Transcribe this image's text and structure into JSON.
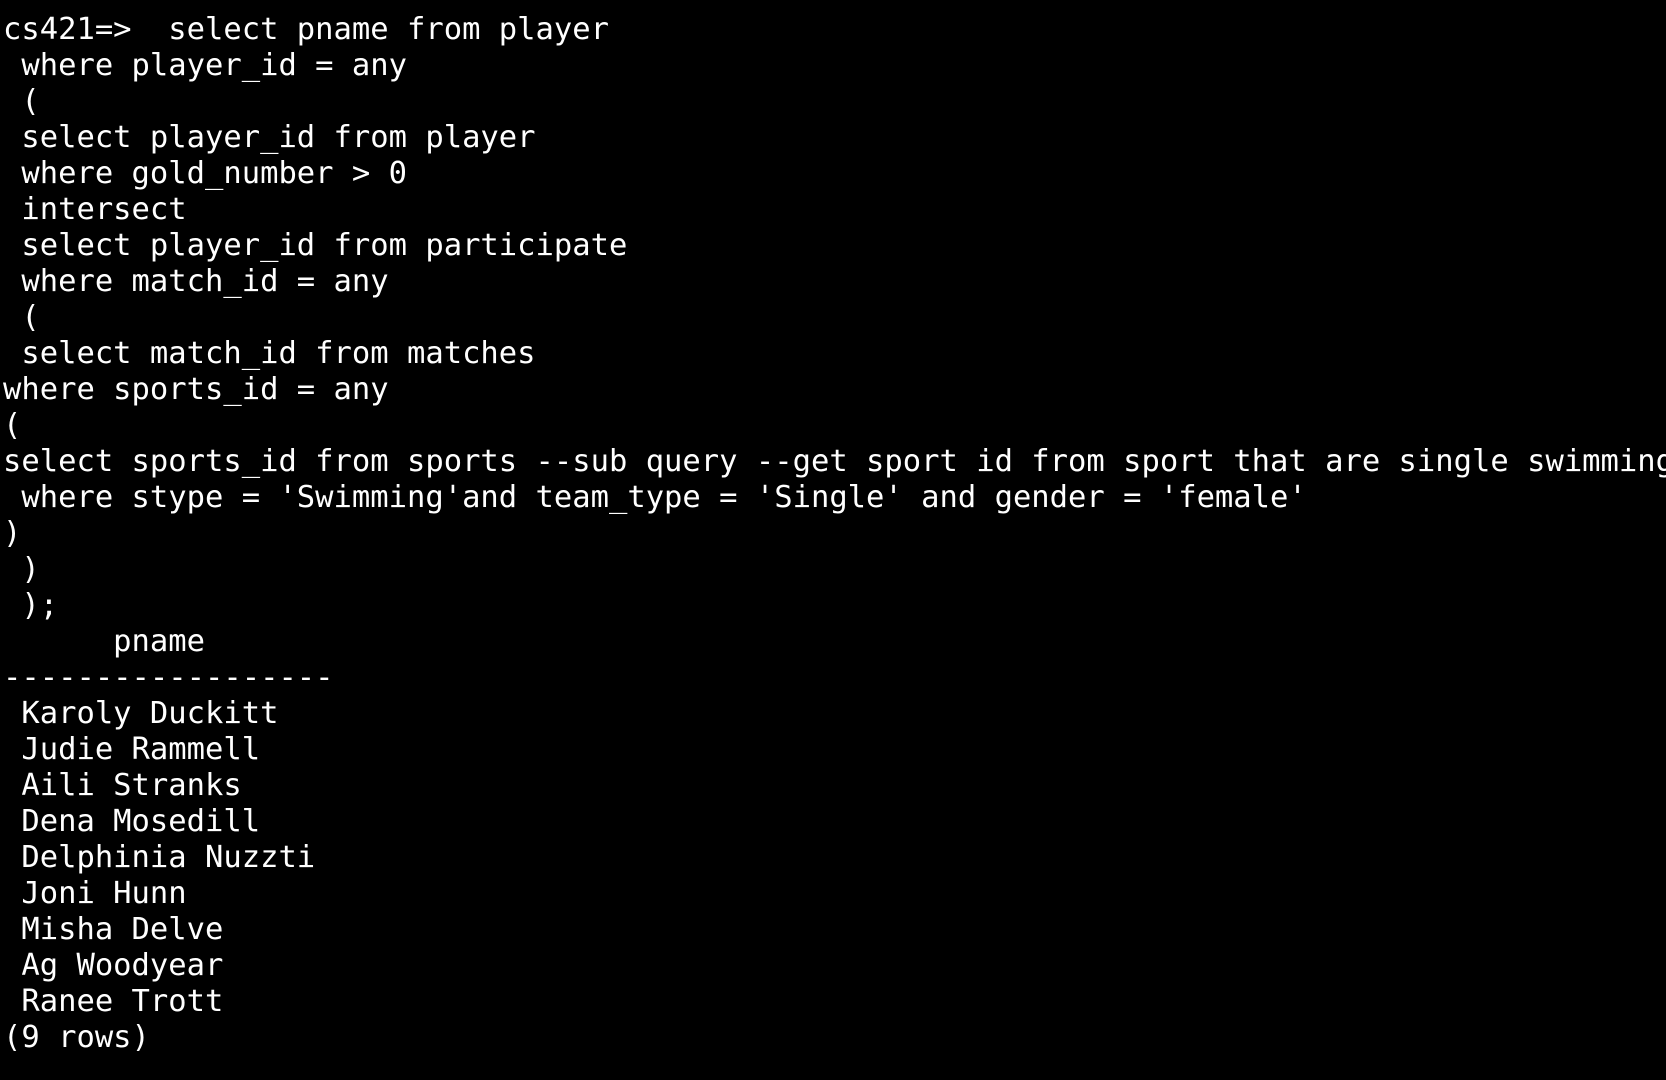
{
  "terminal": {
    "prompt": "cs421=>",
    "query_lines": [
      "cs421=>  select pname from player",
      " where player_id = any",
      " (",
      " select player_id from player",
      " where gold_number > 0",
      " intersect",
      " select player_id from participate",
      " where match_id = any",
      " (",
      " select match_id from matches",
      "where sports_id = any",
      "(",
      "select sports_id from sports --sub query --get sport id from sport that are single swimming",
      " where stype = 'Swimming'and team_type = 'Single' and gender = 'female'",
      ")",
      " )",
      " );"
    ],
    "result": {
      "column_header": "      pname",
      "separator": "------------------",
      "rows": [
        " Karoly Duckitt",
        " Judie Rammell",
        " Aili Stranks",
        " Dena Mosedill",
        " Delphinia Nuzzti",
        " Joni Hunn",
        " Misha Delve",
        " Ag Woodyear",
        " Ranee Trott"
      ],
      "row_count": "(9 rows)"
    }
  },
  "colors": {
    "background": "#000000",
    "foreground": "#ffffff"
  }
}
